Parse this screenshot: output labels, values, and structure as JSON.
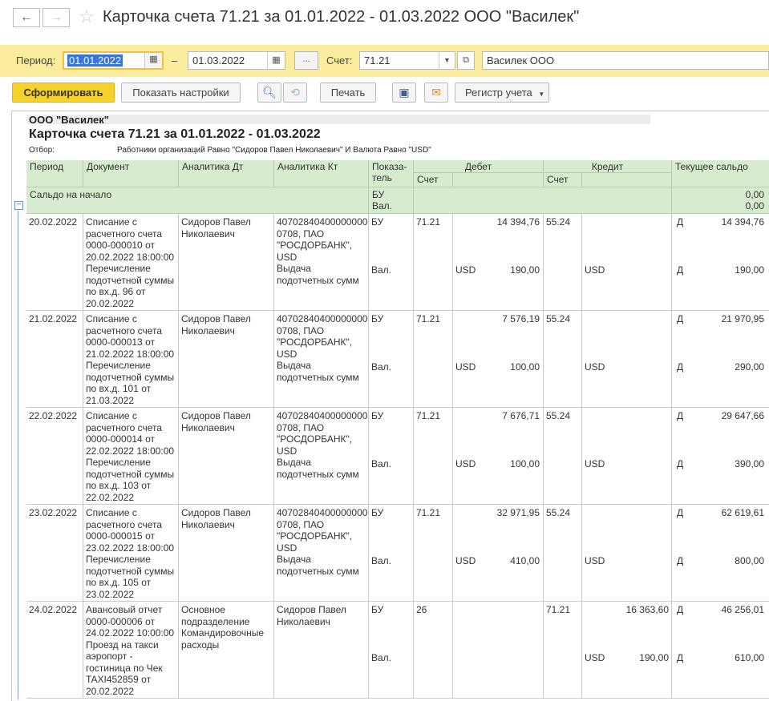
{
  "window": {
    "title": "Карточка счета 71.21 за 01.01.2022 - 01.03.2022 ООО \"Василек\"",
    "back_icon": "←",
    "forward_icon": "→",
    "favorite_icon": "☆"
  },
  "params": {
    "period_label": "Период:",
    "date_from": "01.01.2022",
    "dash": "–",
    "date_to": "01.03.2022",
    "ellipsis": "...",
    "account_label": "Счет:",
    "account": "71.21",
    "organization": "Василек ООО"
  },
  "toolbar": {
    "generate": "Сформировать",
    "show_settings": "Показать настройки",
    "print": "Печать",
    "register": "Регистр учета"
  },
  "report": {
    "org": "ООО \"Василек\"",
    "title": "Карточка счета 71.21 за 01.01.2022 - 01.03.2022",
    "filter_label": "Отбор:",
    "filter_value": "Работники организаций Равно \"Сидоров Павел Николаевич\" И Валюта Равно \"USD\"",
    "columns": {
      "period": "Период",
      "document": "Документ",
      "analytics_dt": "Аналитика Дт",
      "analytics_kt": "Аналитика Кт",
      "indicator": "Показа-\nтель",
      "debit": "Дебет",
      "credit": "Кредит",
      "balance": "Текущее сальдо",
      "account": "Счет"
    },
    "opening": {
      "label": "Сальдо на начало",
      "ind1": "БУ",
      "ind2": "Вал.",
      "val1": "0,00",
      "val2": "0,00"
    },
    "rows": [
      {
        "date": "20.02.2022",
        "doc": "Списание с\nрасчетного счета\n0000-000010 от\n20.02.2022 18:00:00\nПеречисление\nподотчетной суммы\nпо вх.д. 96 от\n20.02.2022",
        "an_dt": "Сидоров Павел\nНиколаевич",
        "an_kt": "40702840400000000\n0708, ПАО\n\"РОСДОРБАНК\",\nUSD\nВыдача\nподотчетных сумм",
        "ind_bu": "БУ",
        "ind_val": "Вал.",
        "dt_acc": "71.21",
        "dt_amount": "14 394,76",
        "dt_cur": "USD",
        "dt_cur_amount": "190,00",
        "kt_acc": "55.24",
        "kt_amount": "",
        "kt_cur": "USD",
        "kt_cur_amount": "",
        "bal_dir1": "Д",
        "bal1": "14 394,76",
        "bal_dir2": "Д",
        "bal2": "190,00"
      },
      {
        "date": "21.02.2022",
        "doc": "Списание с\nрасчетного счета\n0000-000013 от\n21.02.2022 18:00:00\nПеречисление\nподотчетной суммы\nпо вх.д. 101 от\n21.03.2022",
        "an_dt": "Сидоров Павел\nНиколаевич",
        "an_kt": "40702840400000000\n0708, ПАО\n\"РОСДОРБАНК\",\nUSD\nВыдача\nподотчетных сумм",
        "ind_bu": "БУ",
        "ind_val": "Вал.",
        "dt_acc": "71.21",
        "dt_amount": "7 576,19",
        "dt_cur": "USD",
        "dt_cur_amount": "100,00",
        "kt_acc": "55.24",
        "kt_amount": "",
        "kt_cur": "USD",
        "kt_cur_amount": "",
        "bal_dir1": "Д",
        "bal1": "21 970,95",
        "bal_dir2": "Д",
        "bal2": "290,00"
      },
      {
        "date": "22.02.2022",
        "doc": "Списание с\nрасчетного счета\n0000-000014 от\n22.02.2022 18:00:00\nПеречисление\nподотчетной суммы\nпо вх.д. 103 от\n22.02.2022",
        "an_dt": "Сидоров Павел\nНиколаевич",
        "an_kt": "40702840400000000\n0708, ПАО\n\"РОСДОРБАНК\",\nUSD\nВыдача\nподотчетных сумм",
        "ind_bu": "БУ",
        "ind_val": "Вал.",
        "dt_acc": "71.21",
        "dt_amount": "7 676,71",
        "dt_cur": "USD",
        "dt_cur_amount": "100,00",
        "kt_acc": "55.24",
        "kt_amount": "",
        "kt_cur": "USD",
        "kt_cur_amount": "",
        "bal_dir1": "Д",
        "bal1": "29 647,66",
        "bal_dir2": "Д",
        "bal2": "390,00"
      },
      {
        "date": "23.02.2022",
        "doc": "Списание с\nрасчетного счета\n0000-000015 от\n23.02.2022 18:00:00\nПеречисление\nподотчетной суммы\nпо вх.д. 105 от\n23.02.2022",
        "an_dt": "Сидоров Павел\nНиколаевич",
        "an_kt": "40702840400000000\n0708, ПАО\n\"РОСДОРБАНК\",\nUSD\nВыдача\nподотчетных сумм",
        "ind_bu": "БУ",
        "ind_val": "Вал.",
        "dt_acc": "71.21",
        "dt_amount": "32 971,95",
        "dt_cur": "USD",
        "dt_cur_amount": "410,00",
        "kt_acc": "55.24",
        "kt_amount": "",
        "kt_cur": "USD",
        "kt_cur_amount": "",
        "bal_dir1": "Д",
        "bal1": "62 619,61",
        "bal_dir2": "Д",
        "bal2": "800,00"
      },
      {
        "date": "24.02.2022",
        "doc": "Авансовый отчет\n0000-000006 от\n24.02.2022 10:00:00\nПроезд на такси\nаэропорт -\nгостиница по Чек\nTAXI452859 от\n20.02.2022",
        "an_dt": "Основное\nподразделение\nКомандировочные\nрасходы",
        "an_kt": "Сидоров Павел\nНиколаевич",
        "ind_bu": "БУ",
        "ind_val": "Вал.",
        "dt_acc": "26",
        "dt_amount": "",
        "dt_cur": "",
        "dt_cur_amount": "",
        "kt_acc": "71.21",
        "kt_amount": "16 363,60",
        "kt_cur": "USD",
        "kt_cur_amount": "190,00",
        "bal_dir1": "Д",
        "bal1": "46 256,01",
        "bal_dir2": "Д",
        "bal2": "610,00"
      }
    ]
  }
}
